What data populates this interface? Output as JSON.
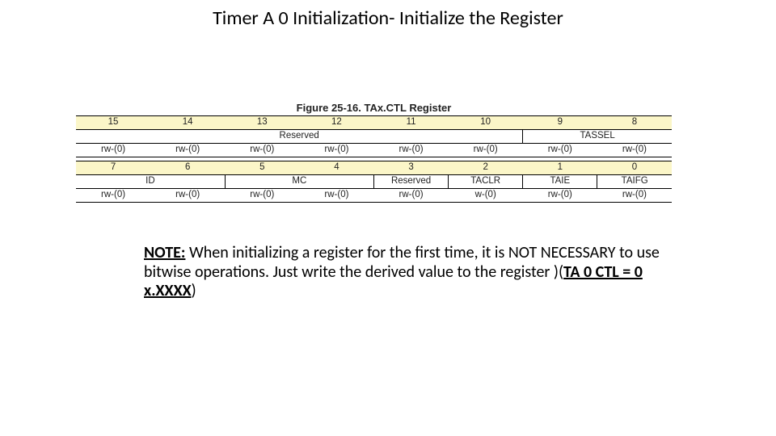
{
  "title": "Timer A 0 Initialization- Initialize the Register",
  "figure": {
    "caption": "Figure 25-16. TAx.CTL Register",
    "bits_high": [
      "15",
      "14",
      "13",
      "12",
      "11",
      "10",
      "9",
      "8"
    ],
    "names_high": {
      "reserved": "Reserved",
      "tassel": "TASSEL"
    },
    "rw_high": [
      "rw-(0)",
      "rw-(0)",
      "rw-(0)",
      "rw-(0)",
      "rw-(0)",
      "rw-(0)",
      "rw-(0)",
      "rw-(0)"
    ],
    "bits_low": [
      "7",
      "6",
      "5",
      "4",
      "3",
      "2",
      "1",
      "0"
    ],
    "names_low": {
      "id": "ID",
      "mc": "MC",
      "reserved": "Reserved",
      "taclr": "TACLR",
      "taie": "TAIE",
      "taifg": "TAIFG"
    },
    "rw_low": [
      "rw-(0)",
      "rw-(0)",
      "rw-(0)",
      "rw-(0)",
      "rw-(0)",
      "w-(0)",
      "rw-(0)",
      "rw-(0)"
    ]
  },
  "note": {
    "label": "NOTE:",
    "body1": "When initializing a register for the first time, it is NOT NECESSARY to use bitwise operations.  Just write the derived value to the register )(",
    "emph": "TA 0 CTL = 0 x.XXXX",
    "body2": ")"
  }
}
